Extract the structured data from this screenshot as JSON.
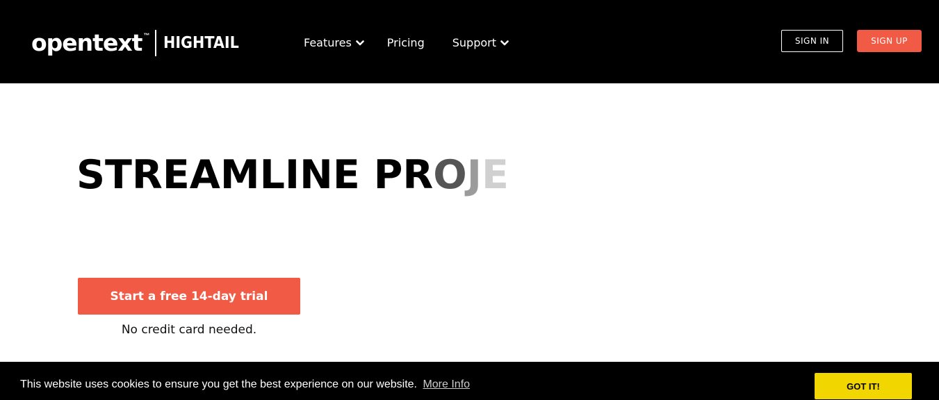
{
  "header": {
    "brand": {
      "opentext": "opentext",
      "tm": "™",
      "hightail": "HIGHTAIL"
    },
    "nav": {
      "features": "Features",
      "pricing": "Pricing",
      "support": "Support"
    },
    "sign_in": "SIGN IN",
    "sign_up": "SIGN UP"
  },
  "hero": {
    "title_solid": "STREAMLINE PR",
    "title_fade1": "O",
    "title_fade2": "J",
    "title_fade3": "E",
    "cta_label": "Start a free 14-day trial",
    "cta_note": "No credit card needed."
  },
  "cookie_banner": {
    "message": "This website uses cookies to ensure you get the best experience on our website.",
    "more_info": "More Info",
    "accept_label": "GOT IT!"
  },
  "colors": {
    "header_bg": "#000000",
    "accent": "#f15b45",
    "cookie_button": "#f1d600"
  },
  "icons": {
    "features_dropdown": "chevron-down-icon",
    "support_dropdown": "chevron-down-icon"
  }
}
